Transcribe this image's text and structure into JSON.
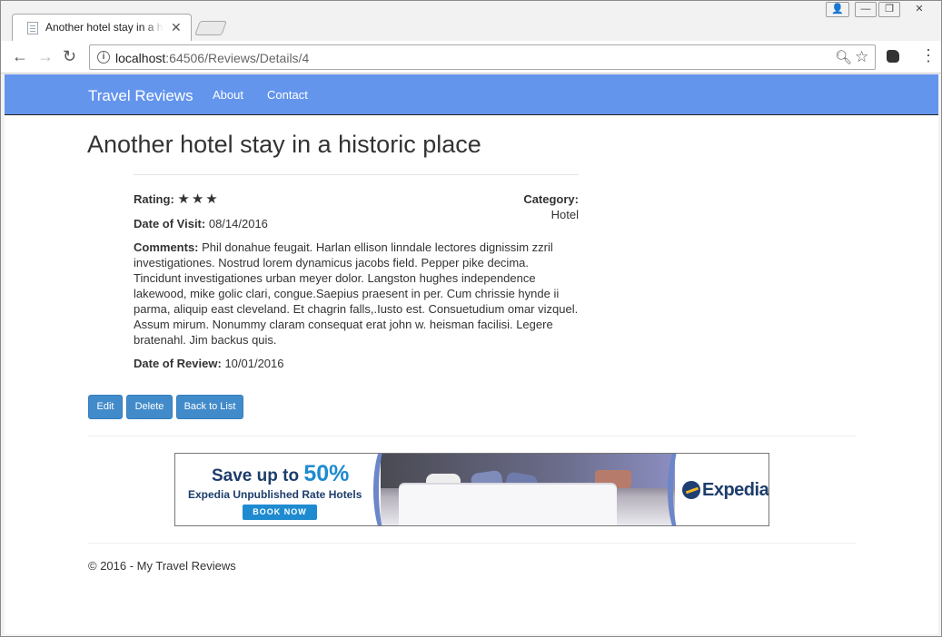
{
  "browser": {
    "tab_title": "Another hotel stay in a historic place",
    "tab_close": "✕",
    "url_host": "localhost",
    "url_rest": ":64506/Reviews/Details/4",
    "window_controls": {
      "user": "👤",
      "minimize": "—",
      "maximize": "❐",
      "close": "✕"
    }
  },
  "site": {
    "brand": "Travel Reviews",
    "nav": {
      "about": "About",
      "contact": "Contact"
    }
  },
  "review": {
    "title": "Another hotel stay in a historic place",
    "rating_label": "Rating:",
    "rating_stars": "★★★",
    "rating_value": 3,
    "category_label": "Category:",
    "category": "Hotel",
    "visit_label": "Date of Visit:",
    "visit_date": "08/14/2016",
    "comments_label": "Comments:",
    "comments": "Phil donahue feugait. Harlan ellison linndale lectores dignissim zzril investigationes. Nostrud lorem dynamicus jacobs field. Pepper pike decima. Tincidunt investigationes urban meyer dolor. Langston hughes independence lakewood, mike golic clari, congue.Saepius praesent in per. Cum chrissie hynde ii parma, aliquip east cleveland. Et chagrin falls,.Iusto est. Consuetudium omar vizquel. Assum mirum. Nonummy claram consequat erat john w. heisman facilisi. Legere bratenahl. Jim backus quis.",
    "review_label": "Date of Review:",
    "review_date": "10/01/2016"
  },
  "actions": {
    "edit": "Edit",
    "delete": "Delete",
    "back": "Back to List"
  },
  "ad": {
    "save_text": "Save up to ",
    "save_pct": "50%",
    "subtitle": "Expedia Unpublished Rate Hotels",
    "cta": "BOOK NOW",
    "brand": "Expedia"
  },
  "footer": "© 2016 - My Travel Reviews"
}
